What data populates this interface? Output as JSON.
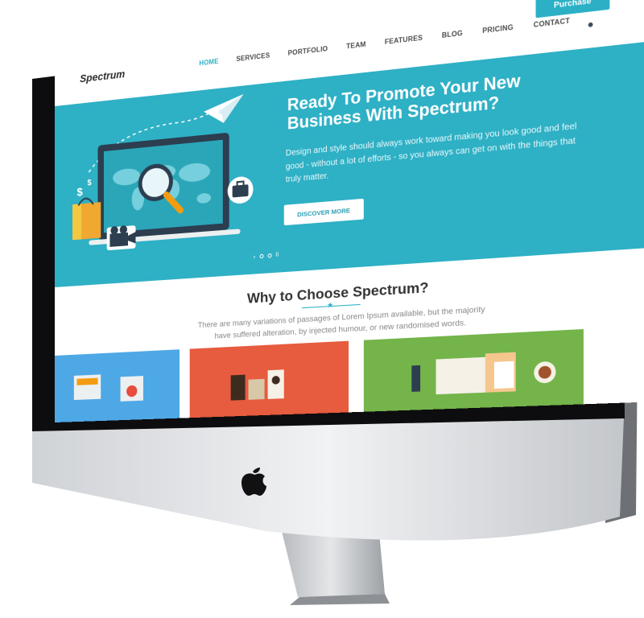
{
  "site": {
    "logo": "Spectrum",
    "nav": [
      {
        "label": "HOME",
        "active": true
      },
      {
        "label": "SERVICES",
        "active": false
      },
      {
        "label": "PORTFOLIO",
        "active": false
      },
      {
        "label": "TEAM",
        "active": false
      },
      {
        "label": "FEATURES",
        "active": false
      },
      {
        "label": "BLOG",
        "active": false
      },
      {
        "label": "PRICING",
        "active": false
      },
      {
        "label": "CONTACT",
        "active": false
      }
    ],
    "purchase_label": "Purchase"
  },
  "hero": {
    "title": "Ready To Promote Your New Business With Spectrum?",
    "text": "Design and style should always work toward making you look good and feel good - without a lot of efforts - so you always can get on with the things that truly matter.",
    "button_label": "DISCOVER MORE",
    "slider_arrow": "›",
    "slider_pause": "II",
    "dollar_sign": "$"
  },
  "why": {
    "title": "Why to Choose Spectrum?",
    "text": "There are many variations of passages of Lorem Ipsum available, but the majority have suffered alteration, by injected humour, or new randomised words."
  },
  "colors": {
    "accent": "#2cb0c6",
    "hero_bg": "#2eb0c5",
    "card_blue": "#4fa8e6",
    "card_red": "#e75b3e",
    "card_green": "#74b44a"
  },
  "icons": [
    "paper-plane-icon",
    "magnifier-icon",
    "briefcase-icon",
    "dollar-icon",
    "shopping-bag-icon",
    "camera-icon",
    "apple-logo-icon",
    "star-icon",
    "search-icon"
  ]
}
